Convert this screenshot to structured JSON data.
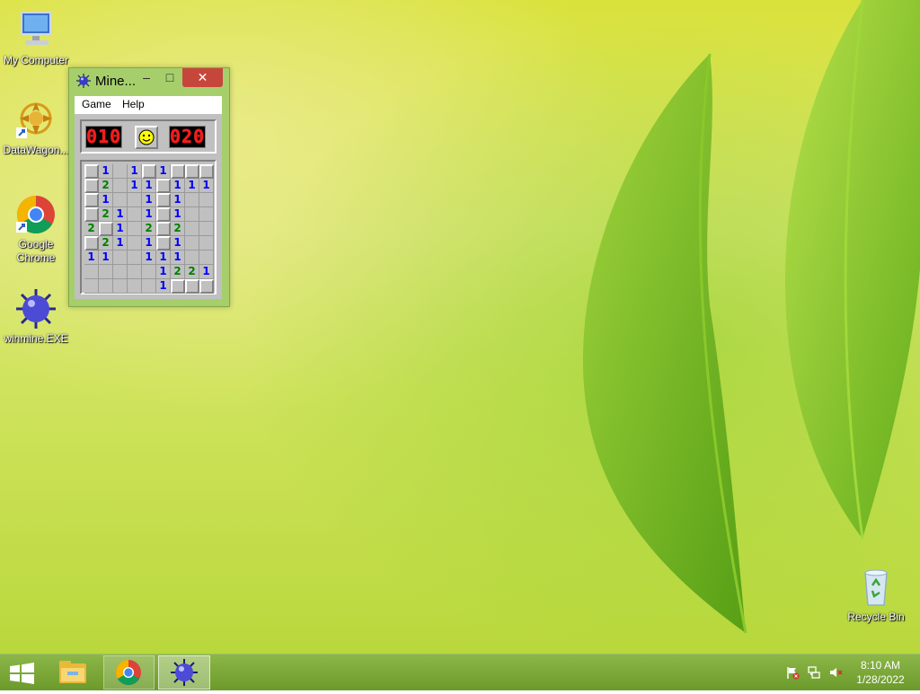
{
  "desktop": {
    "icons": [
      {
        "label": "My Computer",
        "icon": "computer-icon"
      },
      {
        "label": "DataWagon...",
        "icon": "datawagon-icon"
      },
      {
        "label": "Google Chrome",
        "icon": "chrome-icon"
      },
      {
        "label": "winmine.EXE",
        "icon": "mine-icon"
      },
      {
        "label": "Recycle Bin",
        "icon": "recycle-bin-icon"
      }
    ]
  },
  "window": {
    "title": "Mine...",
    "buttons": {
      "minimize": "–",
      "maximize": "□",
      "close": "✕"
    },
    "menu": [
      "Game",
      "Help"
    ]
  },
  "game": {
    "mines_counter": "010",
    "timer": "020",
    "face": "smiley",
    "number_colors": {
      "1": "#0000ff",
      "2": "#008000"
    },
    "board": [
      [
        "#",
        "1",
        "",
        "1",
        "#",
        "1",
        "#",
        "#",
        "#"
      ],
      [
        "#",
        "2",
        "",
        "1",
        "1",
        "#",
        "1",
        "1",
        "1"
      ],
      [
        "#",
        "1",
        "",
        "",
        "1",
        "#",
        "1",
        "",
        ""
      ],
      [
        "#",
        "2",
        "1",
        "",
        "1",
        "#",
        "1",
        "",
        ""
      ],
      [
        "2",
        "#",
        "1",
        "",
        "2",
        "#",
        "2",
        "",
        ""
      ],
      [
        "#",
        "2",
        "1",
        "",
        "1",
        "#",
        "1",
        "",
        ""
      ],
      [
        "1",
        "1",
        "",
        "",
        "1",
        "1",
        "1",
        "",
        ""
      ],
      [
        "",
        "",
        "",
        "",
        "",
        "1",
        "2",
        "2",
        "1"
      ],
      [
        "",
        "",
        "",
        "",
        "",
        "1",
        "#",
        "#",
        "#"
      ]
    ]
  },
  "taskbar": {
    "items": [
      "start-icon",
      "file-explorer-icon",
      "chrome-icon",
      "mine-icon"
    ],
    "tray": [
      "action-center-flag-icon",
      "network-icon",
      "volume-muted-icon"
    ],
    "time": "8:10 AM",
    "date": "1/28/2022"
  },
  "colors": {
    "close_button": "#c7463b",
    "taskbar": "#6e9e25",
    "window_frame": "#a6cf6b"
  }
}
